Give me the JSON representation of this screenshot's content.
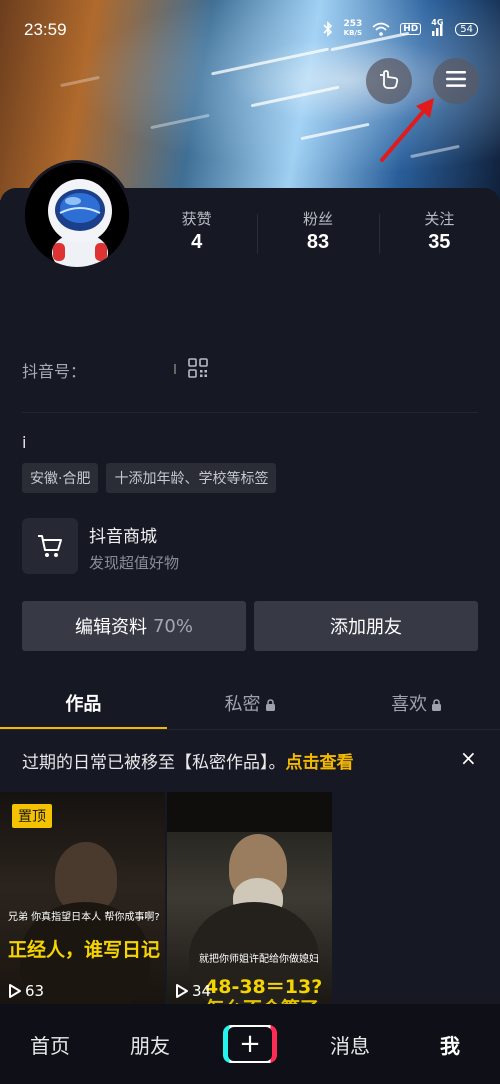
{
  "status_bar": {
    "time": "23:59",
    "net_speed_value": "253",
    "net_speed_unit": "KB/S",
    "hd": "HD",
    "signal": "4G",
    "battery": "54"
  },
  "header": {
    "gesture_icon": "hand-pointer-icon",
    "menu_icon": "hamburger-menu-icon"
  },
  "profile": {
    "stats": [
      {
        "label": "获赞",
        "value": "4"
      },
      {
        "label": "粉丝",
        "value": "83"
      },
      {
        "label": "关注",
        "value": "35"
      }
    ],
    "douyin_id_label": "抖音号：",
    "bio": "i",
    "tags": [
      "安徽·合肥",
      "十添加年龄、学校等标签"
    ]
  },
  "mall": {
    "title": "抖音商城",
    "subtitle": "发现超值好物"
  },
  "actions": {
    "edit_label": "编辑资料",
    "edit_percent": "70%",
    "add_friend_label": "添加朋友"
  },
  "tabs": [
    {
      "label": "作品"
    },
    {
      "label": "私密"
    },
    {
      "label": "喜欢"
    }
  ],
  "notice": {
    "text": "过期的日常已被移至【私密作品】。",
    "link": "点击查看",
    "close": "×"
  },
  "videos": [
    {
      "pinned_label": "置顶",
      "caption_small": "兄弟 你真指望日本人 帮你成事啊?",
      "caption_big": "正经人，谁写日记",
      "plays": "63"
    },
    {
      "caption_small": "就把你师姐许配给你做媳妇",
      "caption_big": "48-38＝13?",
      "caption_big2": "怎么不会算了",
      "plays": "34"
    }
  ],
  "bottom_nav": {
    "home": "首页",
    "friends": "朋友",
    "create": "+",
    "messages": "消息",
    "me": "我"
  },
  "colors": {
    "accent": "#f5b800",
    "background": "#161823",
    "button": "#373945"
  }
}
